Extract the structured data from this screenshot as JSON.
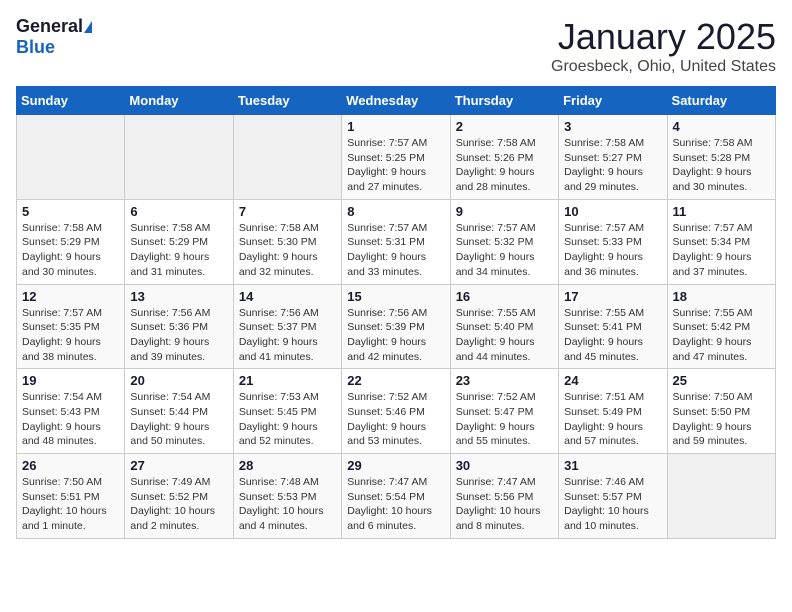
{
  "header": {
    "logo_general": "General",
    "logo_blue": "Blue",
    "title": "January 2025",
    "subtitle": "Groesbeck, Ohio, United States"
  },
  "days_of_week": [
    "Sunday",
    "Monday",
    "Tuesday",
    "Wednesday",
    "Thursday",
    "Friday",
    "Saturday"
  ],
  "weeks": [
    [
      {
        "day": "",
        "info": ""
      },
      {
        "day": "",
        "info": ""
      },
      {
        "day": "",
        "info": ""
      },
      {
        "day": "1",
        "info": "Sunrise: 7:57 AM\nSunset: 5:25 PM\nDaylight: 9 hours and 27 minutes."
      },
      {
        "day": "2",
        "info": "Sunrise: 7:58 AM\nSunset: 5:26 PM\nDaylight: 9 hours and 28 minutes."
      },
      {
        "day": "3",
        "info": "Sunrise: 7:58 AM\nSunset: 5:27 PM\nDaylight: 9 hours and 29 minutes."
      },
      {
        "day": "4",
        "info": "Sunrise: 7:58 AM\nSunset: 5:28 PM\nDaylight: 9 hours and 30 minutes."
      }
    ],
    [
      {
        "day": "5",
        "info": "Sunrise: 7:58 AM\nSunset: 5:29 PM\nDaylight: 9 hours and 30 minutes."
      },
      {
        "day": "6",
        "info": "Sunrise: 7:58 AM\nSunset: 5:29 PM\nDaylight: 9 hours and 31 minutes."
      },
      {
        "day": "7",
        "info": "Sunrise: 7:58 AM\nSunset: 5:30 PM\nDaylight: 9 hours and 32 minutes."
      },
      {
        "day": "8",
        "info": "Sunrise: 7:57 AM\nSunset: 5:31 PM\nDaylight: 9 hours and 33 minutes."
      },
      {
        "day": "9",
        "info": "Sunrise: 7:57 AM\nSunset: 5:32 PM\nDaylight: 9 hours and 34 minutes."
      },
      {
        "day": "10",
        "info": "Sunrise: 7:57 AM\nSunset: 5:33 PM\nDaylight: 9 hours and 36 minutes."
      },
      {
        "day": "11",
        "info": "Sunrise: 7:57 AM\nSunset: 5:34 PM\nDaylight: 9 hours and 37 minutes."
      }
    ],
    [
      {
        "day": "12",
        "info": "Sunrise: 7:57 AM\nSunset: 5:35 PM\nDaylight: 9 hours and 38 minutes."
      },
      {
        "day": "13",
        "info": "Sunrise: 7:56 AM\nSunset: 5:36 PM\nDaylight: 9 hours and 39 minutes."
      },
      {
        "day": "14",
        "info": "Sunrise: 7:56 AM\nSunset: 5:37 PM\nDaylight: 9 hours and 41 minutes."
      },
      {
        "day": "15",
        "info": "Sunrise: 7:56 AM\nSunset: 5:39 PM\nDaylight: 9 hours and 42 minutes."
      },
      {
        "day": "16",
        "info": "Sunrise: 7:55 AM\nSunset: 5:40 PM\nDaylight: 9 hours and 44 minutes."
      },
      {
        "day": "17",
        "info": "Sunrise: 7:55 AM\nSunset: 5:41 PM\nDaylight: 9 hours and 45 minutes."
      },
      {
        "day": "18",
        "info": "Sunrise: 7:55 AM\nSunset: 5:42 PM\nDaylight: 9 hours and 47 minutes."
      }
    ],
    [
      {
        "day": "19",
        "info": "Sunrise: 7:54 AM\nSunset: 5:43 PM\nDaylight: 9 hours and 48 minutes."
      },
      {
        "day": "20",
        "info": "Sunrise: 7:54 AM\nSunset: 5:44 PM\nDaylight: 9 hours and 50 minutes."
      },
      {
        "day": "21",
        "info": "Sunrise: 7:53 AM\nSunset: 5:45 PM\nDaylight: 9 hours and 52 minutes."
      },
      {
        "day": "22",
        "info": "Sunrise: 7:52 AM\nSunset: 5:46 PM\nDaylight: 9 hours and 53 minutes."
      },
      {
        "day": "23",
        "info": "Sunrise: 7:52 AM\nSunset: 5:47 PM\nDaylight: 9 hours and 55 minutes."
      },
      {
        "day": "24",
        "info": "Sunrise: 7:51 AM\nSunset: 5:49 PM\nDaylight: 9 hours and 57 minutes."
      },
      {
        "day": "25",
        "info": "Sunrise: 7:50 AM\nSunset: 5:50 PM\nDaylight: 9 hours and 59 minutes."
      }
    ],
    [
      {
        "day": "26",
        "info": "Sunrise: 7:50 AM\nSunset: 5:51 PM\nDaylight: 10 hours and 1 minute."
      },
      {
        "day": "27",
        "info": "Sunrise: 7:49 AM\nSunset: 5:52 PM\nDaylight: 10 hours and 2 minutes."
      },
      {
        "day": "28",
        "info": "Sunrise: 7:48 AM\nSunset: 5:53 PM\nDaylight: 10 hours and 4 minutes."
      },
      {
        "day": "29",
        "info": "Sunrise: 7:47 AM\nSunset: 5:54 PM\nDaylight: 10 hours and 6 minutes."
      },
      {
        "day": "30",
        "info": "Sunrise: 7:47 AM\nSunset: 5:56 PM\nDaylight: 10 hours and 8 minutes."
      },
      {
        "day": "31",
        "info": "Sunrise: 7:46 AM\nSunset: 5:57 PM\nDaylight: 10 hours and 10 minutes."
      },
      {
        "day": "",
        "info": ""
      }
    ]
  ]
}
